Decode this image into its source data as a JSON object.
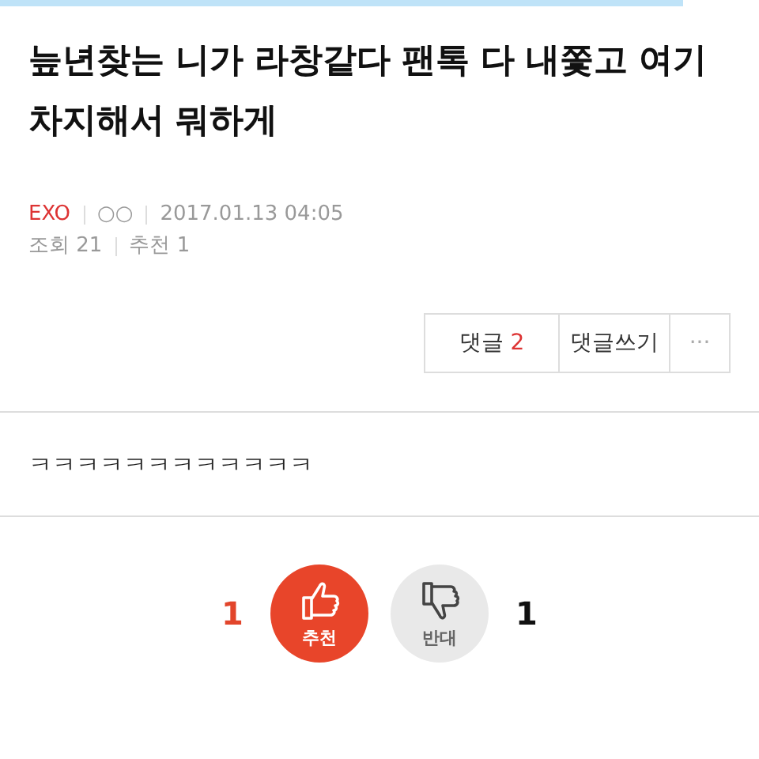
{
  "post": {
    "title": "늪년찾는 니가 라창같다 팬톡 다 내쫓고 여기 차지해서 뭐하게",
    "board": "EXO",
    "author": "○○",
    "date": "2017.01.13 04:05",
    "views": "조회 21",
    "recommends": "추천 1"
  },
  "actions": {
    "comments_label": "댓글",
    "comments_count": "2",
    "write": "댓글쓰기",
    "more": "···"
  },
  "body": "ㅋㅋㅋㅋㅋㅋㅋㅋㅋㅋㅋㅋ",
  "votes": [
    {
      "kind": "up",
      "count": "1",
      "label": "추천"
    },
    {
      "kind": "down",
      "count": "1",
      "label": "반대"
    }
  ]
}
